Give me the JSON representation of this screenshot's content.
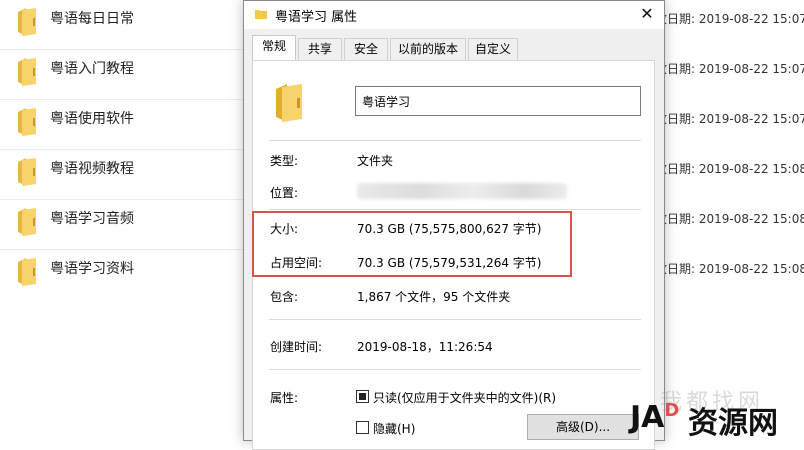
{
  "explorer": {
    "rows": [
      {
        "name": "粤语每日日常",
        "date": "改日期: 2019-08-22 15:07"
      },
      {
        "name": "粤语入门教程",
        "date": "改日期: 2019-08-22 15:07"
      },
      {
        "name": "粤语使用软件",
        "date": "改日期: 2019-08-22 15:07"
      },
      {
        "name": "粤语视频教程",
        "date": "改日期: 2019-08-22 15:08"
      },
      {
        "name": "粤语学习音频",
        "date": "改日期: 2019-08-22 15:08"
      },
      {
        "name": "粤语学习资料",
        "date": "改日期: 2019-08-22 15:08"
      }
    ],
    "folder_color": "#f2c94c"
  },
  "dialog": {
    "title": "粤语学习 属性",
    "close_glyph": "✕",
    "tabs": [
      "常规",
      "共享",
      "安全",
      "以前的版本",
      "自定义"
    ],
    "active_tab": "常规",
    "folder_name": "粤语学习",
    "type_label": "类型:",
    "type_value": "文件夹",
    "location_label": "位置:",
    "size_label": "大小:",
    "size_value": "70.3 GB (75,575,800,627 字节)",
    "disk_label": "占用空间:",
    "disk_value": "70.3 GB (75,579,531,264 字节)",
    "contains_label": "包含:",
    "contains_value": "1,867 个文件，95 个文件夹",
    "created_label": "创建时间:",
    "created_value": "2019-08-18，11:26:54",
    "attributes_label": "属性:",
    "readonly_label": "只读(仅应用于文件夹中的文件)(R)",
    "hidden_label": "隐藏(H)",
    "advanced_button": "高级(D)...",
    "highlight_color": "#d9534f"
  },
  "watermark": {
    "ghost_text": "我都找网",
    "logo_text": "JA",
    "logo_accent": "D",
    "brand": "资源网"
  }
}
